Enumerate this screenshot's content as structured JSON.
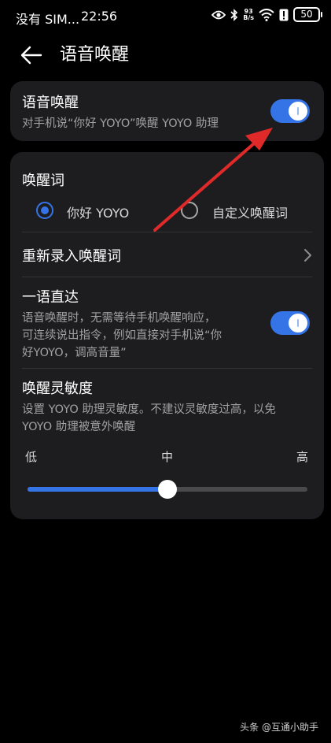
{
  "status": {
    "carrier": "没有 SIM...",
    "time": "22:56",
    "speed_top": "93",
    "speed_bottom": "B/s",
    "battery": "50"
  },
  "header": {
    "title": "语音唤醒"
  },
  "wake_card": {
    "title": "语音唤醒",
    "subtitle": "对手机说“你好 YOYO”唤醒 YOYO 助理",
    "enabled": true
  },
  "wake_word": {
    "title": "唤醒词",
    "options": [
      {
        "label": "你好 YOYO",
        "selected": true
      },
      {
        "label": "自定义唤醒词",
        "selected": false
      }
    ]
  },
  "rerecord": {
    "label": "重新录入唤醒词"
  },
  "direct": {
    "title": "一语直达",
    "subtitle_lines": [
      "语音唤醒时，无需等待手机唤醒响应，",
      "可连续说出指令，例如直接对手机说“你",
      "好YOYO，调高音量”"
    ],
    "enabled": true
  },
  "sensitivity": {
    "title": "唤醒灵敏度",
    "subtitle_lines": [
      "设置 YOYO 助理灵敏度。不建议灵敏度过高，以免",
      "YOYO 助理被意外唤醒"
    ],
    "labels": {
      "low": "低",
      "mid": "中",
      "high": "高"
    },
    "value": 0.5
  },
  "watermark": "头条 @互通小助手",
  "colors": {
    "accent": "#3574e6",
    "card": "#1d1d1f",
    "arrow": "#e02a2a"
  }
}
